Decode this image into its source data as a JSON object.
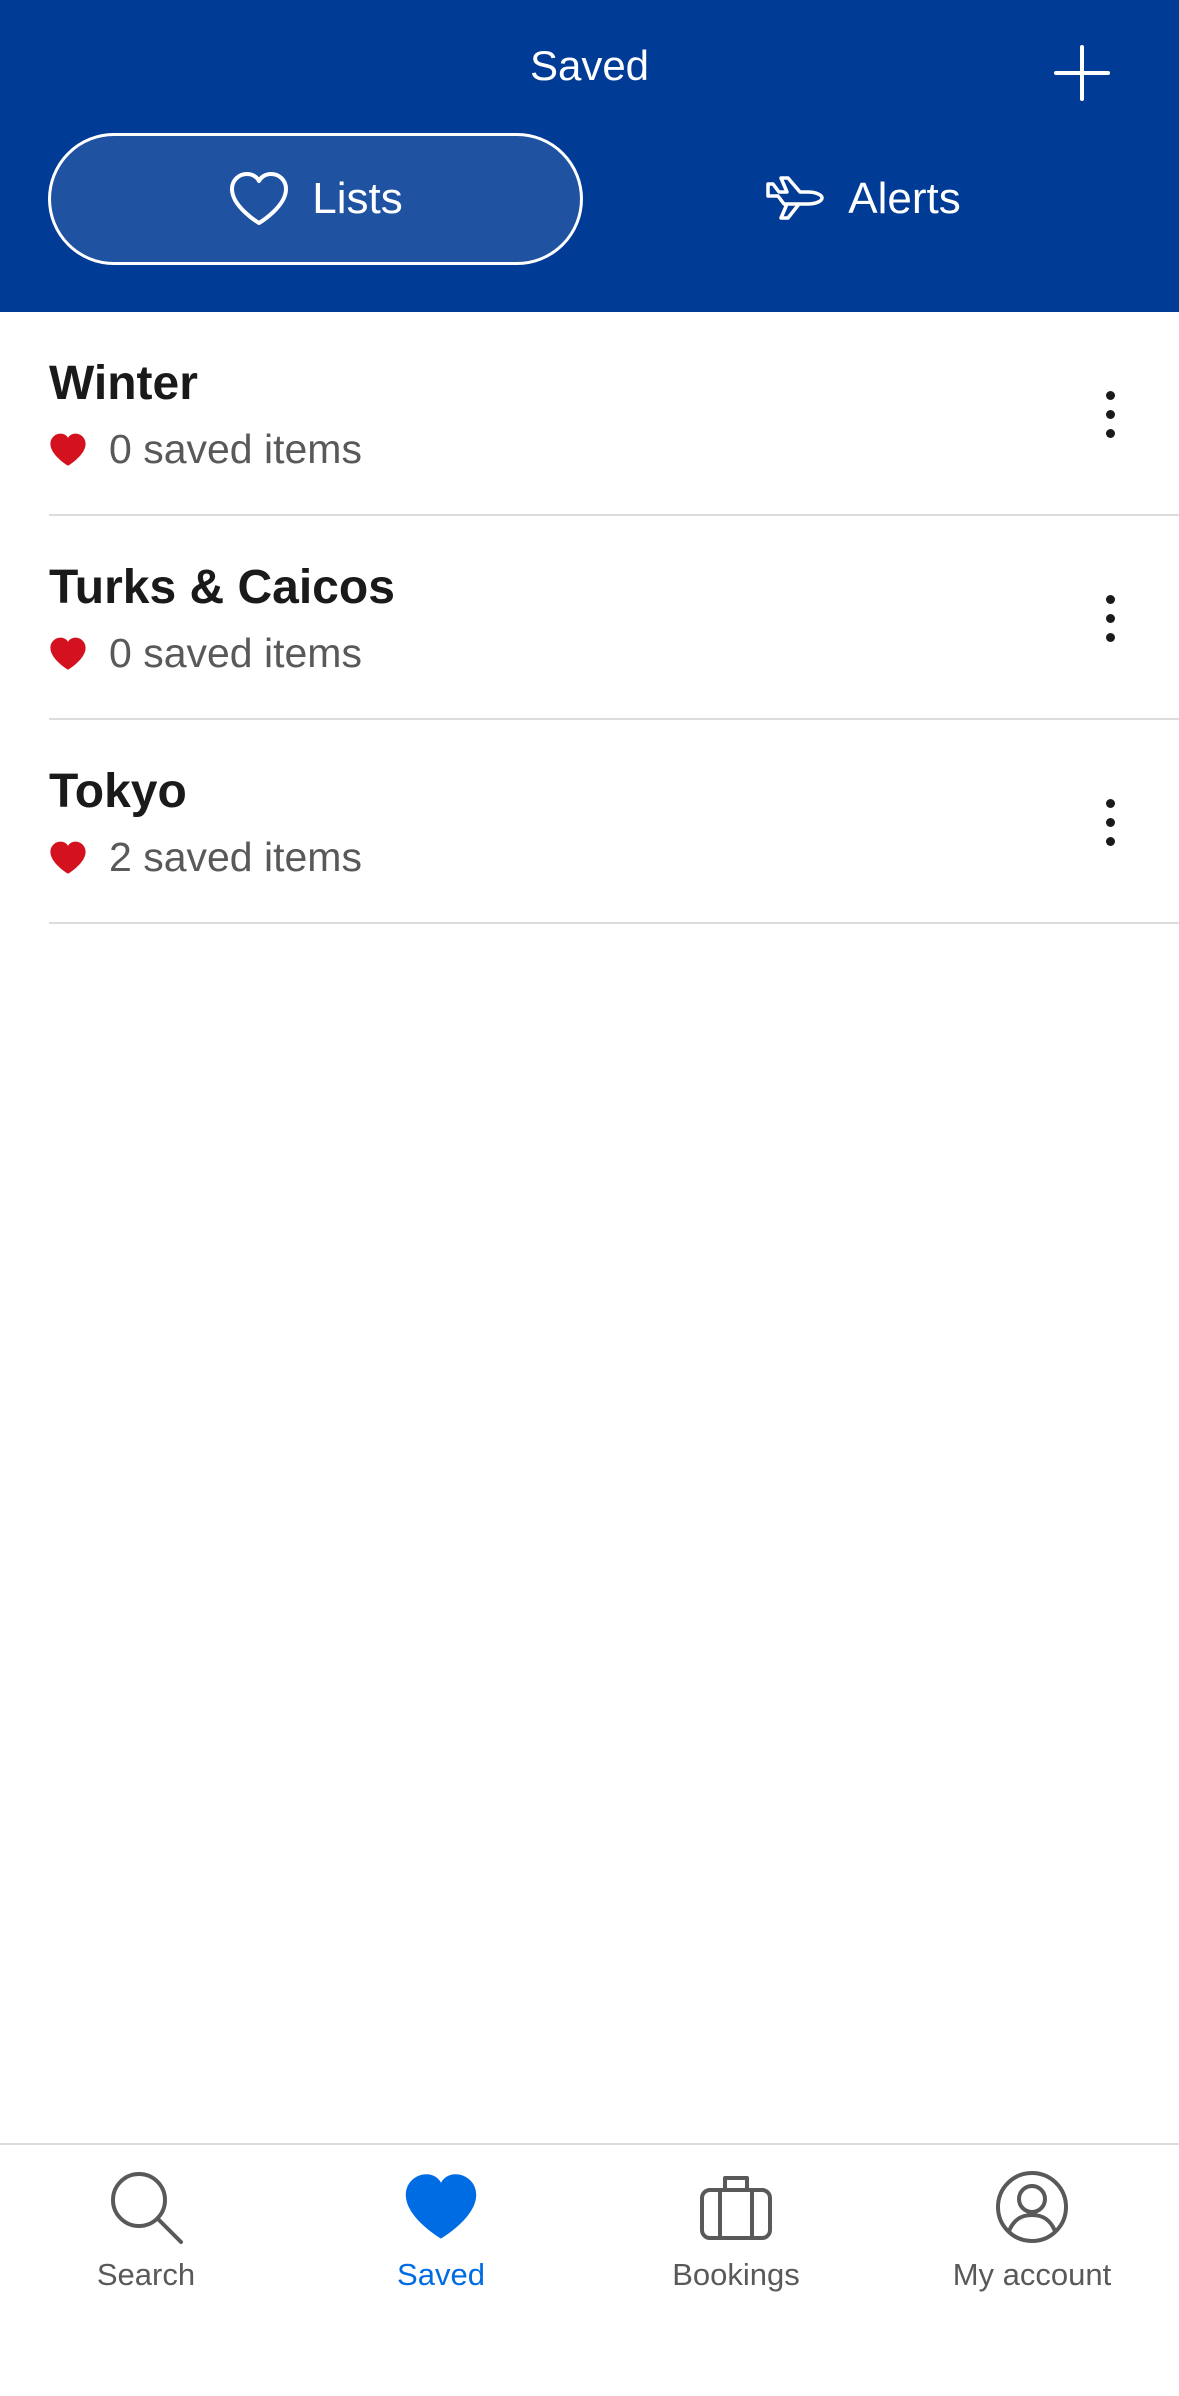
{
  "header": {
    "title": "Saved",
    "add_icon": "plus-icon"
  },
  "tabs": [
    {
      "label": "Lists",
      "icon": "heart-outline-icon",
      "active": true
    },
    {
      "label": "Alerts",
      "icon": "airplane-icon",
      "active": false
    }
  ],
  "lists": [
    {
      "title": "Winter",
      "count": "0 saved items"
    },
    {
      "title": "Turks & Caicos",
      "count": "0 saved items"
    },
    {
      "title": "Tokyo",
      "count": "2 saved items"
    }
  ],
  "bottom_nav": [
    {
      "label": "Search",
      "icon": "search-icon",
      "active": false
    },
    {
      "label": "Saved",
      "icon": "heart-icon",
      "active": true
    },
    {
      "label": "Bookings",
      "icon": "briefcase-icon",
      "active": false
    },
    {
      "label": "My account",
      "icon": "account-icon",
      "active": false
    }
  ],
  "colors": {
    "header_bg": "#003b95",
    "heart_red": "#d4111e",
    "active_blue": "#006ce4",
    "text_secondary": "#595959"
  }
}
